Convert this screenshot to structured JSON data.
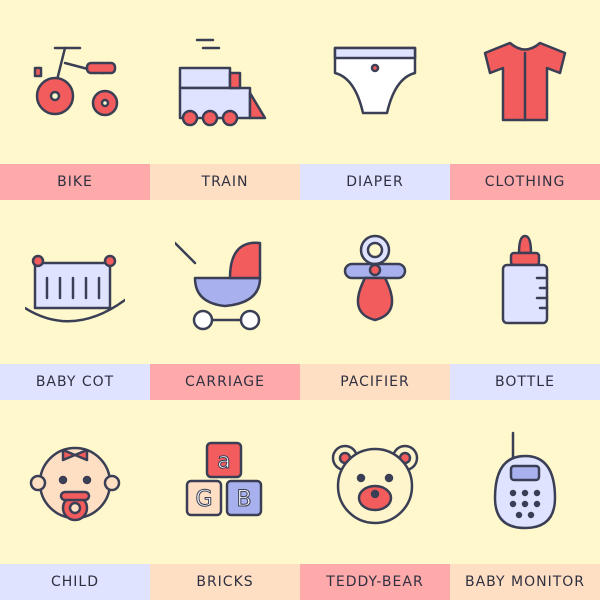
{
  "colors": {
    "background": "#fff8cc",
    "pink": "#ffaaaa",
    "peach": "#ffdfc4",
    "lavender": "#dfe3ff",
    "accent_red": "#f25c5c",
    "accent_blue": "#a9b0ee",
    "text": "#2e3040"
  },
  "items": [
    {
      "label": "BIKE",
      "icon": "tricycle-icon",
      "band": "pink"
    },
    {
      "label": "TRAIN",
      "icon": "toy-train-icon",
      "band": "peach"
    },
    {
      "label": "DIAPER",
      "icon": "diaper-icon",
      "band": "lavender"
    },
    {
      "label": "CLOTHING",
      "icon": "onesie-icon",
      "band": "pink"
    },
    {
      "label": "BABY COT",
      "icon": "crib-icon",
      "band": "lavender"
    },
    {
      "label": "CARRIAGE",
      "icon": "stroller-icon",
      "band": "pink"
    },
    {
      "label": "PACIFIER",
      "icon": "pacifier-icon",
      "band": "peach"
    },
    {
      "label": "BOTTLE",
      "icon": "baby-bottle-icon",
      "band": "lavender"
    },
    {
      "label": "CHILD",
      "icon": "baby-face-icon",
      "band": "lavender"
    },
    {
      "label": "BRICKS",
      "icon": "letter-blocks-icon",
      "band": "peach"
    },
    {
      "label": "TEDDY-BEAR",
      "icon": "teddy-bear-icon",
      "band": "pink"
    },
    {
      "label": "BABY MONITOR",
      "icon": "baby-monitor-icon",
      "band": "peach"
    }
  ],
  "blocks": {
    "top": "a",
    "left": "G",
    "right": "B"
  }
}
